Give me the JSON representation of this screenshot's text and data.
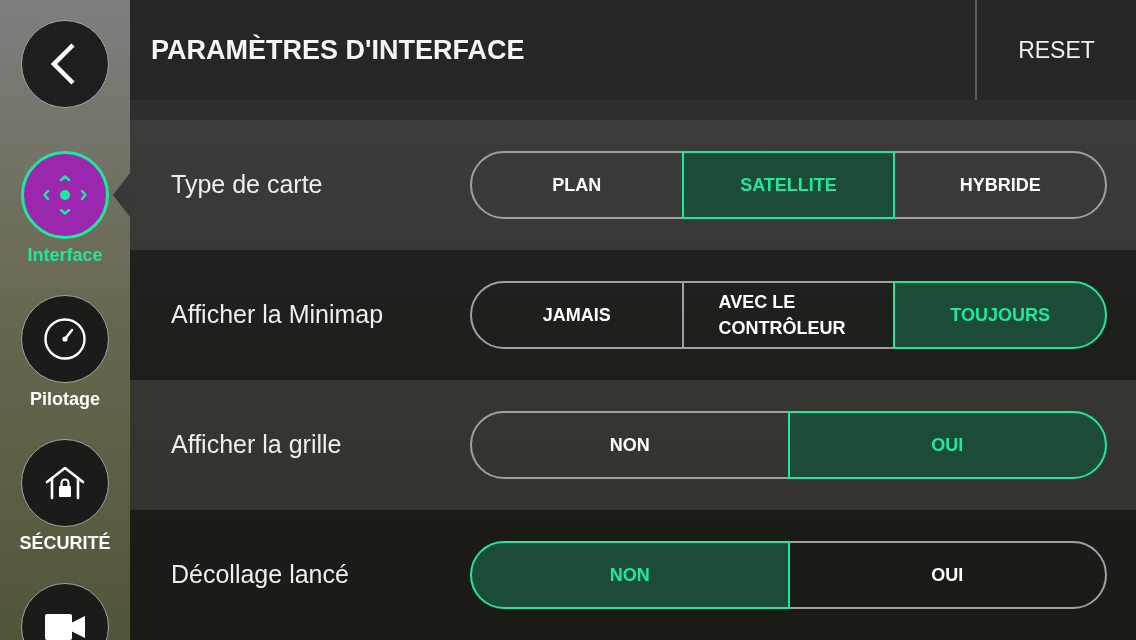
{
  "sidebar": {
    "items": [
      {
        "label": "Interface",
        "selected": true
      },
      {
        "label": "Pilotage",
        "selected": false
      },
      {
        "label": "SÉCURITÉ",
        "selected": false
      },
      {
        "selected": false
      }
    ]
  },
  "header": {
    "title": "PARAMÈTRES D'INTERFACE",
    "reset_button": "RESET"
  },
  "settings": [
    {
      "label": "Type de carte",
      "options": [
        {
          "label": "PLAN",
          "selected": false
        },
        {
          "label": "SATELLITE",
          "selected": true
        },
        {
          "label": "HYBRIDE",
          "selected": false
        }
      ]
    },
    {
      "label": "Afficher la Minimap",
      "options": [
        {
          "label": "JAMAIS",
          "selected": false
        },
        {
          "label": "AVEC LE CONTRÔLEUR",
          "selected": false
        },
        {
          "label": "TOUJOURS",
          "selected": true
        }
      ]
    },
    {
      "label": "Afficher la grille",
      "options": [
        {
          "label": "NON",
          "selected": false
        },
        {
          "label": "OUI",
          "selected": true
        }
      ]
    },
    {
      "label": "Décollage lancé",
      "options": [
        {
          "label": "NON",
          "selected": true
        },
        {
          "label": "OUI",
          "selected": false
        }
      ]
    }
  ]
}
